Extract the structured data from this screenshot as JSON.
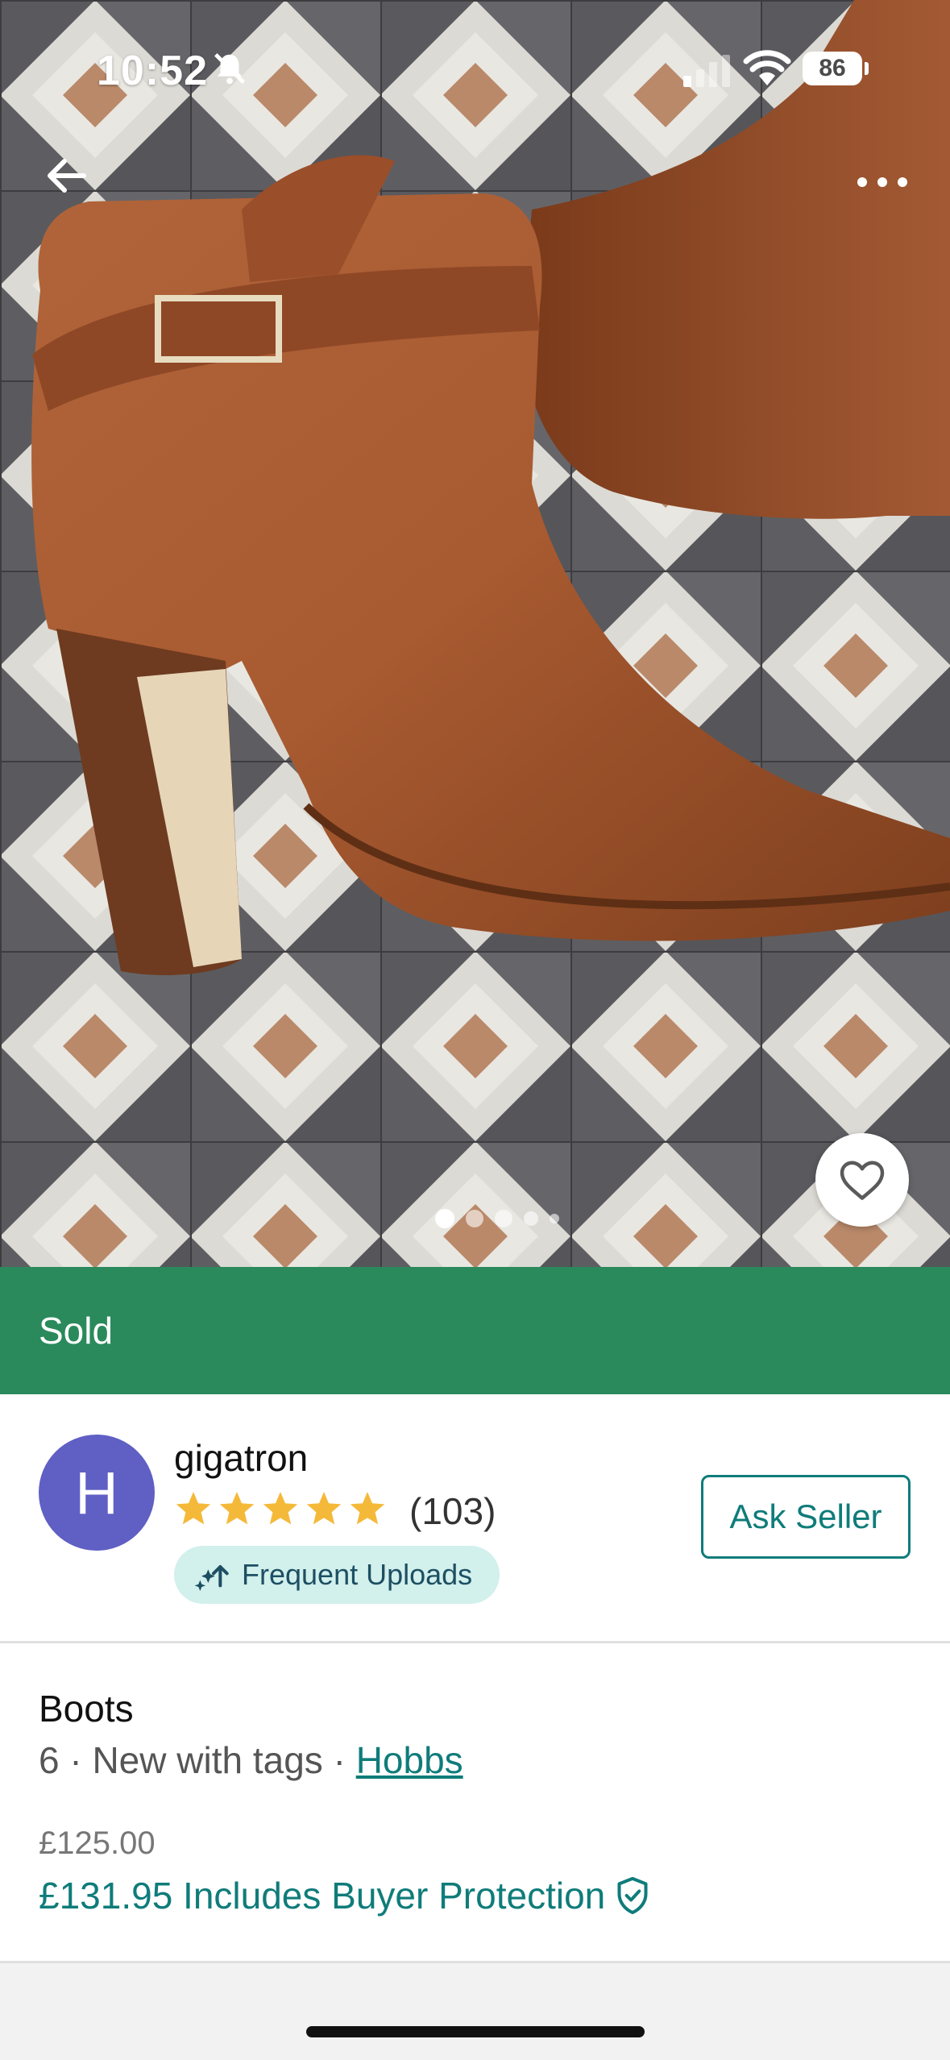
{
  "status_bar": {
    "time": "10:52",
    "battery": "86",
    "icons": [
      "bell-slash-icon",
      "signal-icon",
      "wifi-icon"
    ]
  },
  "nav": {
    "back_icon": "arrow-left-icon",
    "more_icon": "more-horizontal-icon"
  },
  "gallery": {
    "image_subject": "tan leather heeled ankle boot on tiled floor",
    "favorite_icon": "heart-icon",
    "pages": 5,
    "current_page": 1
  },
  "banner": {
    "label": "Sold",
    "color": "#2a8a5c"
  },
  "seller": {
    "avatar_letter": "H",
    "avatar_color": "#5f5fc4",
    "name": "gigatron",
    "rating_stars": 5,
    "review_count": "(103)",
    "badge_label": "Frequent Uploads",
    "badge_icon": "sparkle-upload-icon",
    "ask_button": "Ask Seller"
  },
  "item": {
    "title": "Boots",
    "meta_prefix": "6 · New with tags · ",
    "brand": "Hobbs",
    "price": "£125.00",
    "price_total": "£131.95 Includes Buyer Protection",
    "protection_icon": "shield-check-icon"
  },
  "colors": {
    "accent": "#0f7c7a",
    "star": "#f5b93a"
  }
}
